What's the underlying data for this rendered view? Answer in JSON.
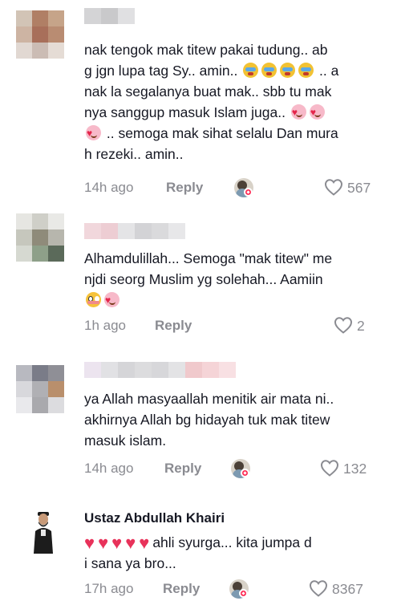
{
  "comments": [
    {
      "text_parts": [
        "nak tengok mak titew pakai tudung.. ab\ng jgn lupa tag Sy.. amin.. ",
        "cry",
        "cry",
        "cry",
        "cry",
        " .. a\nnak la segalanya buat mak.. sbb tu mak\nnya sanggup masuk Islam juga.. ",
        "hearts",
        "hearts",
        "\n",
        "hearts",
        " .. semoga mak sihat selalu Dan mura\nh rezeki.. amin.."
      ],
      "time": "14h ago",
      "reply": "Reply",
      "likes": "567",
      "creator_liked": true
    },
    {
      "text_parts": [
        "Alhamdulillah... Semoga \"mak titew\" me\nnjdi seorg Muslim yg solehah... Aamiin\n",
        "flushed",
        "hearts"
      ],
      "time": "1h ago",
      "reply": "Reply",
      "likes": "2",
      "creator_liked": false
    },
    {
      "text_parts": [
        "ya Allah masyaallah menitik air mata ni..\nakhirnya Allah bg hidayah tuk mak titew\nmasuk islam."
      ],
      "time": "14h ago",
      "reply": "Reply",
      "likes": "132",
      "creator_liked": true
    },
    {
      "username": "Ustaz Abdullah Khairi",
      "text_parts": [
        "heart",
        "heart",
        "heart",
        "heart",
        "heart",
        "ahli syurga... kita jumpa d\ni sana ya bro..."
      ],
      "time": "17h ago",
      "reply": "Reply",
      "likes": "8367",
      "creator_liked": true
    }
  ],
  "colors": {
    "text": "#161823",
    "meta": "#8a8b91",
    "accent": "#fe2c55"
  },
  "icons": {
    "like": "heart-outline-icon",
    "creator_badge": "creator-liked-avatar-icon"
  }
}
